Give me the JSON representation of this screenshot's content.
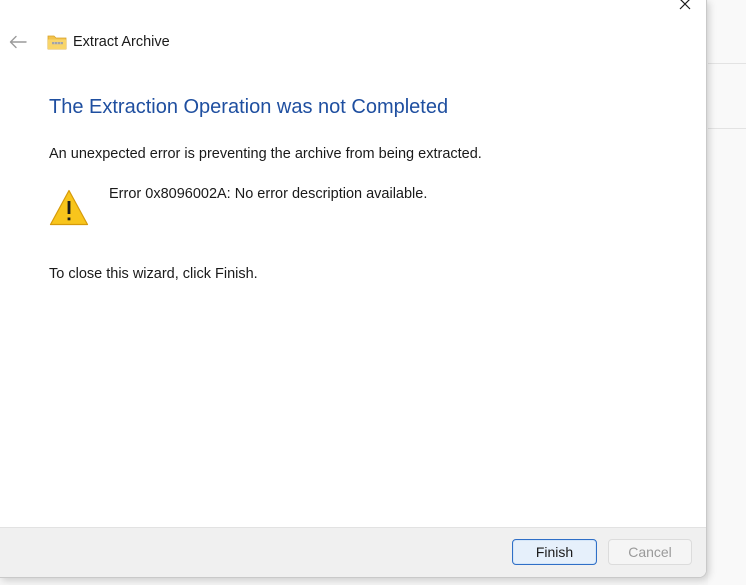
{
  "window": {
    "title": "Extract Archive",
    "close_icon": "close-icon",
    "back_icon": "back-arrow-icon",
    "app_icon": "zip-folder-icon"
  },
  "content": {
    "heading": "The Extraction Operation was not Completed",
    "intro": "An unexpected error is preventing the archive from being extracted.",
    "error_message": "Error 0x8096002A: No error description available.",
    "warning_icon": "warning-icon",
    "close_hint": "To close this wizard, click Finish."
  },
  "footer": {
    "finish_label": "Finish",
    "cancel_label": "Cancel",
    "cancel_disabled": true
  },
  "colors": {
    "heading": "#1f4fa0",
    "finish_border": "#2f6fc7",
    "warning_fill": "#f8c51c"
  }
}
